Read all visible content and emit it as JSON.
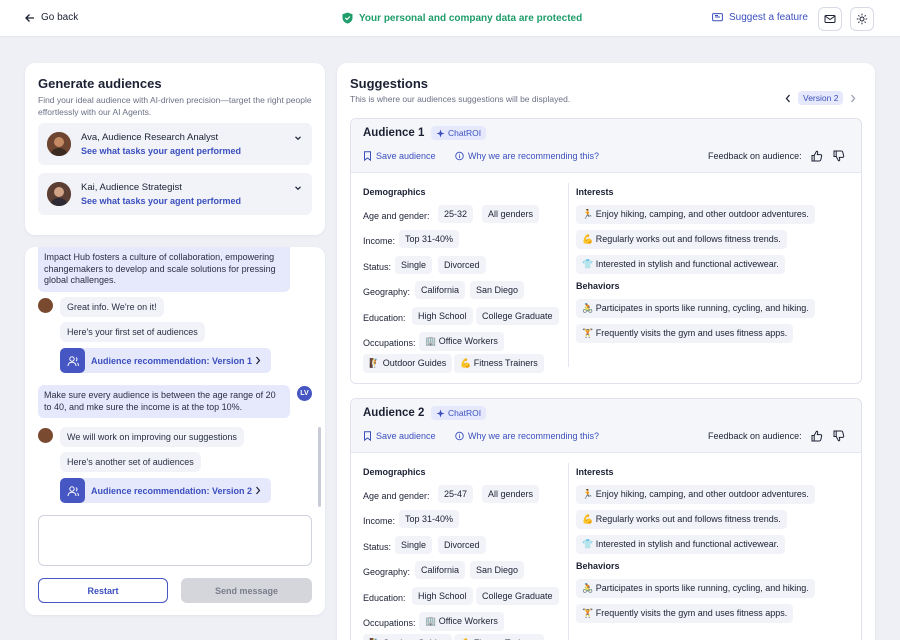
{
  "topbar": {
    "go_back": "Go back",
    "protected": "Your personal and company data are protected",
    "suggest": "Suggest a feature"
  },
  "generate": {
    "title": "Generate audiences",
    "subtitle": "Find your ideal audience with AI-driven precision—target the right people effortlessly with our AI Agents.",
    "agents": [
      {
        "name": "Ava, Audience Research Analyst",
        "link": "See what tasks your agent performed"
      },
      {
        "name": "Kai, Audience Strategist",
        "link": "See what tasks your agent performed"
      }
    ]
  },
  "chat": {
    "msg_top": "Impact Hub fosters a culture of collaboration, empowering changemakers to develop and scale solutions for pressing global challenges.",
    "ai_1": "Great info. We're on it!",
    "ai_2": "Here's your first set of audiences",
    "rec_1": "Audience recommendation: Version 1",
    "user_1": "Make sure every audience is between the age range of 20 to 40, and mke sure the income is at the top 10%.",
    "user_initials": "LV",
    "ai_3": "We will work on improving our suggestions",
    "ai_4": "Here's another set of audiences",
    "rec_2": "Audience recommendation: Version 2",
    "restart": "Restart",
    "send": "Send message"
  },
  "suggestions": {
    "title": "Suggestions",
    "subtitle": "This is where our audiences suggestions will be displayed.",
    "version": "Version 2",
    "audiences": [
      {
        "title": "Audience 1",
        "badge": "ChatROI",
        "save": "Save audience",
        "why": "Why we are recommending this?",
        "feedback": "Feedback on audience:",
        "demographics": "Demographics",
        "age_label": "Age and gender:",
        "age": "25-32",
        "gender": "All genders",
        "income_label": "Income:",
        "income": "Top 31-40%",
        "status_label": "Status:",
        "status": [
          "Single",
          "Divorced"
        ],
        "geo_label": "Geography:",
        "geo": [
          "California",
          "San Diego"
        ],
        "edu_label": "Education:",
        "edu": [
          "High School",
          "College Graduate"
        ],
        "occ_label": "Occupations:",
        "occ": [
          "🏢 Office Workers",
          "🧗 Outdoor Guides",
          "💪 Fitness Trainers"
        ],
        "interests_label": "Interests",
        "interests": [
          "🏃 Enjoy hiking, camping, and other outdoor adventures.",
          "💪 Regularly works out and follows fitness trends.",
          "👕 Interested in stylish and functional activewear."
        ],
        "behaviors_label": "Behaviors",
        "behaviors": [
          "🚴 Participates in sports like running, cycling, and hiking.",
          "🏋 Frequently visits the gym and uses fitness apps."
        ]
      },
      {
        "title": "Audience 2",
        "badge": "ChatROI",
        "save": "Save audience",
        "why": "Why we are recommending this?",
        "feedback": "Feedback on audience:",
        "demographics": "Demographics",
        "age_label": "Age and gender:",
        "age": "25-47",
        "gender": "All genders",
        "income_label": "Income:",
        "income": "Top 31-40%",
        "status_label": "Status:",
        "status": [
          "Single",
          "Divorced"
        ],
        "geo_label": "Geography:",
        "geo": [
          "California",
          "San Diego"
        ],
        "edu_label": "Education:",
        "edu": [
          "High School",
          "College Graduate"
        ],
        "occ_label": "Occupations:",
        "occ": [
          "🏢 Office Workers",
          "🧗 Outdoor Guides",
          "💪 Fitness Trainers"
        ],
        "interests_label": "Interests",
        "interests": [
          "🏃 Enjoy hiking, camping, and other outdoor adventures.",
          "💪 Regularly works out and follows fitness trends.",
          "👕 Interested in stylish and functional activewear."
        ],
        "behaviors_label": "Behaviors",
        "behaviors": [
          "🚴 Participates in sports like running, cycling, and hiking.",
          "🏋 Frequently visits the gym and uses fitness apps."
        ]
      }
    ]
  }
}
